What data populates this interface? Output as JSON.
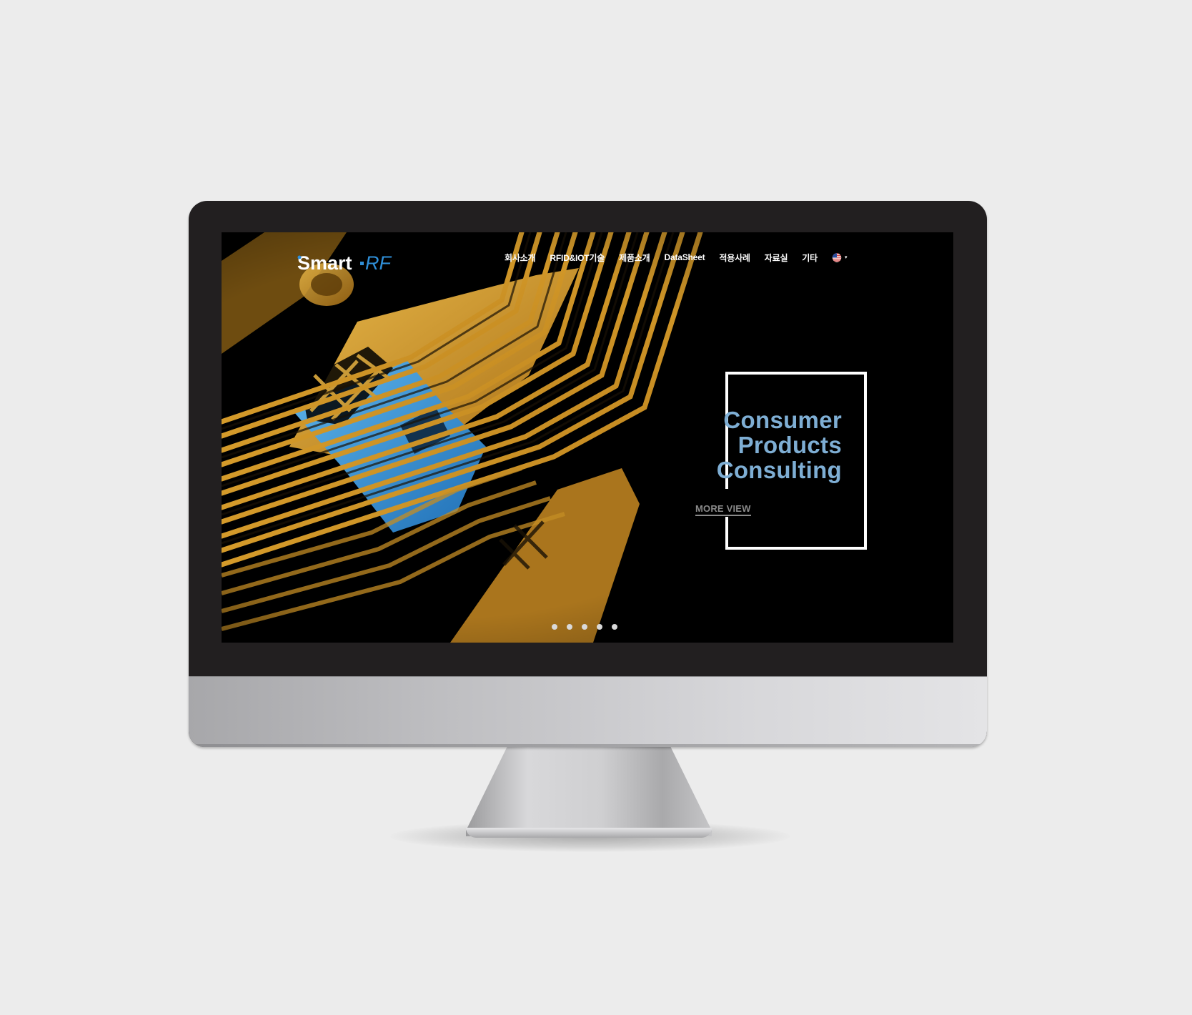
{
  "brand": {
    "logo_text": "Smart-RF",
    "logo_prefix": "Smart",
    "logo_suffix": "RF",
    "logo_accent": "#2f8fd8"
  },
  "nav": {
    "items": [
      {
        "label": "회사소개"
      },
      {
        "label": "RFID&IOT기술"
      },
      {
        "label": "제품소개"
      },
      {
        "label": "DataSheet"
      },
      {
        "label": "적용사례"
      },
      {
        "label": "자료실"
      },
      {
        "label": "기타"
      }
    ],
    "language_icon": "us-flag-icon",
    "language_caret": "▾"
  },
  "hero": {
    "headline_lines": [
      "Consumer",
      "Products",
      "Consulting"
    ],
    "headline_color": "#7eaed4",
    "cta_label": "MORE VIEW",
    "slide_count": 5,
    "active_slide": 1
  },
  "colors": {
    "background": "#ececec",
    "bezel": "#221f20",
    "screen": "#000000",
    "gold": "#d9a93a",
    "chip_blue": "#2e8fd6"
  }
}
